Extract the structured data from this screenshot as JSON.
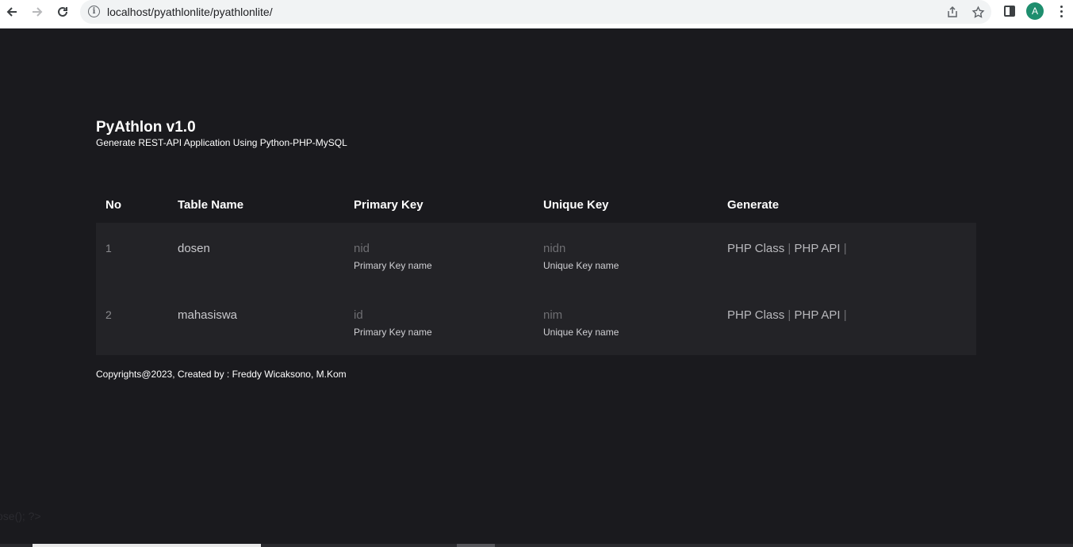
{
  "browser": {
    "url": "localhost/pyathlonlite/pyathlonlite/",
    "avatar_letter": "A",
    "icons": [
      "back-arrow-icon",
      "forward-arrow-icon",
      "reload-icon",
      "info-icon",
      "share-icon",
      "bookmark-star-icon",
      "side-panel-icon",
      "kebab-menu-icon"
    ]
  },
  "header": {
    "title": "PyAthlon v1.0",
    "subtitle": "Generate REST-API Application Using Python-PHP-MySQL"
  },
  "table": {
    "columns": [
      "No",
      "Table Name",
      "Primary Key",
      "Unique Key",
      "Generate"
    ],
    "rows": [
      {
        "no": "1",
        "name": "dosen",
        "primary_key": "nid",
        "primary_hint": "Primary Key name",
        "unique_key": "nidn",
        "unique_hint": "Unique Key name",
        "gen_php_class": "PHP Class",
        "gen_php_api": "PHP API"
      },
      {
        "no": "2",
        "name": "mahasiswa",
        "primary_key": "id",
        "primary_hint": "Primary Key name",
        "unique_key": "nim",
        "unique_hint": "Unique Key name",
        "gen_php_class": "PHP Class",
        "gen_php_api": "PHP API"
      }
    ],
    "separator": "|"
  },
  "footer": {
    "text": "Copyrights@2023, Created by : Freddy Wicaksono, M.Kom"
  },
  "ghost_text": "ose(); ?>",
  "colors": {
    "page_bg": "#1a1a1e",
    "row_bg": "#232327",
    "avatar_bg": "#1e8e6e"
  }
}
